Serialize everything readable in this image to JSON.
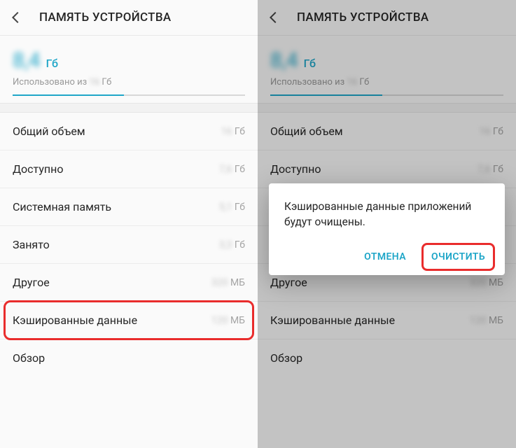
{
  "header": {
    "title": "ПАМЯТЬ УСТРОЙСТВА"
  },
  "usage": {
    "value": "8,4",
    "unit": "Гб",
    "sub_prefix": "Использовано из",
    "sub_blur": "16",
    "sub_unit": "Гб"
  },
  "rows": {
    "total": {
      "label": "Общий объем",
      "blur": "16",
      "unit": "Гб"
    },
    "avail": {
      "label": "Доступно",
      "blur": "7,6",
      "unit": "Гб"
    },
    "system": {
      "label": "Системная память",
      "blur": "5,1",
      "unit": "Гб"
    },
    "used": {
      "label": "Занято",
      "blur": "3,3",
      "unit": "Гб"
    },
    "other": {
      "label": "Другое",
      "blur": "320",
      "unit": "МБ"
    },
    "cached": {
      "label": "Кэшированные данные",
      "blur": "120",
      "unit": "МБ"
    },
    "explore": {
      "label": "Обзор"
    }
  },
  "dialog": {
    "message": "Кэшированные данные приложений будут очищены.",
    "cancel": "ОТМЕНА",
    "clear": "ОЧИСТИТЬ"
  }
}
